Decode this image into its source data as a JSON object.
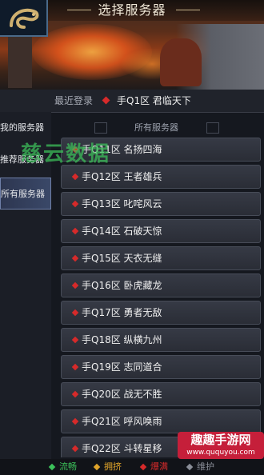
{
  "header": {
    "title": "选择服务器"
  },
  "recent": {
    "label": "最近登录",
    "server": "手Q1区  君临天下"
  },
  "sidebar": {
    "items": [
      {
        "label": "我的服务器"
      },
      {
        "label": "推荐服务器"
      },
      {
        "label": "所有服务器"
      }
    ]
  },
  "main": {
    "section_title": "所有服务器"
  },
  "servers": [
    {
      "label": "手Q11区  名扬四海"
    },
    {
      "label": "手Q12区  王者雄兵"
    },
    {
      "label": "手Q13区  叱咤风云"
    },
    {
      "label": "手Q14区  石破天惊"
    },
    {
      "label": "手Q15区  天衣无缝"
    },
    {
      "label": "手Q16区  卧虎藏龙"
    },
    {
      "label": "手Q17区  勇者无敌"
    },
    {
      "label": "手Q18区  纵横九州"
    },
    {
      "label": "手Q19区  志同道合"
    },
    {
      "label": "手Q20区  战无不胜"
    },
    {
      "label": "手Q21区  呼风唤雨"
    },
    {
      "label": "手Q22区  斗转星移"
    }
  ],
  "legend": [
    {
      "label": "流畅",
      "color": "#3cc25a"
    },
    {
      "label": "拥挤",
      "color": "#e0a42a"
    },
    {
      "label": "爆满",
      "color": "#d62a2a"
    },
    {
      "label": "维护",
      "color": "#8a8e98"
    }
  ],
  "watermarks": {
    "site_text": "趣趣手游网",
    "site_url": "www.ququyou.com",
    "overlay_text": "慈云数据"
  },
  "colors": {
    "status_dot": "#d62a2a",
    "active_tab": "#3a4868"
  }
}
